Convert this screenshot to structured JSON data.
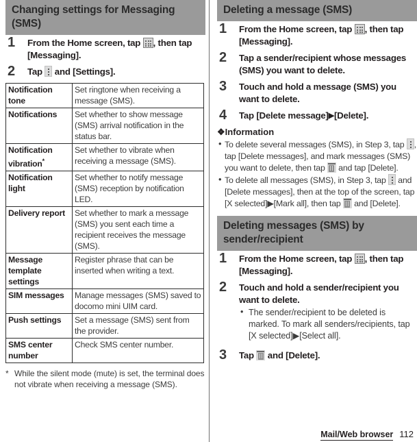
{
  "page": {
    "footer_chapter": "Mail/Web browser",
    "footer_page": "112"
  },
  "left": {
    "section_title": "Changing settings for Messaging (SMS)",
    "steps": [
      {
        "num": "1",
        "pre": "From the Home screen, tap ",
        "icon": "apps-grid-icon",
        "post": ", then tap [Messaging]."
      },
      {
        "num": "2",
        "pre": "Tap ",
        "icon": "overflow-menu-icon",
        "post": " and [Settings]."
      }
    ],
    "table": {
      "rows": [
        {
          "key": "Notification tone",
          "value": "Set ringtone when receiving a message (SMS)."
        },
        {
          "key": "Notifications",
          "value": "Set whether to show message (SMS) arrival notification in the status bar."
        },
        {
          "key": "Notification vibration",
          "key_star": "*",
          "value": "Set whether to vibrate when receiving a message (SMS)."
        },
        {
          "key": "Notification light",
          "value": "Set whether to notify message (SMS) reception by notification LED."
        },
        {
          "key": "Delivery report",
          "value": "Set whether to mark a message (SMS) you sent each time a recipient receives the message (SMS)."
        },
        {
          "key": "Message template settings",
          "value": "Register phrase that can be inserted when writing a text."
        },
        {
          "key": "SIM messages",
          "value": "Manage messages (SMS) saved to docomo mini UIM card."
        },
        {
          "key": "Push settings",
          "value": "Set a message (SMS) sent from the provider."
        },
        {
          "key": "SMS center number",
          "value": "Check SMS center number."
        }
      ]
    },
    "footnote_marker": "*",
    "footnote": "While the silent mode (mute) is set, the terminal does not vibrate when receiving a message (SMS)."
  },
  "right": {
    "section1": {
      "title": "Deleting a message (SMS)",
      "steps": [
        {
          "num": "1",
          "pre": "From the Home screen, tap ",
          "icon": "apps-grid-icon",
          "post": ", then tap [Messaging]."
        },
        {
          "num": "2",
          "pre": "Tap a sender/recipient whose messages (SMS) you want to delete.",
          "icon": "",
          "post": ""
        },
        {
          "num": "3",
          "pre": "Touch and hold a message (SMS) you want to delete.",
          "icon": "",
          "post": ""
        },
        {
          "num": "4",
          "pre": "Tap [Delete message]",
          "icon": "arrow-right-icon",
          "post": "[Delete]."
        }
      ]
    },
    "information": {
      "title": "Information",
      "bullets": [
        {
          "p1": "To delete several messages (SMS), in Step 3, tap ",
          "i1": "overflow-menu-icon",
          "p2": ", tap [Delete messages], and mark messages (SMS) you want to delete, then tap ",
          "i2": "trash-icon",
          "p3": " and tap [Delete]."
        },
        {
          "p1": "To delete all messages (SMS), in Step 3, tap ",
          "i1": "overflow-menu-icon",
          "p2": " and [Delete messages], then at the top of the screen, tap [X selected]▶[Mark all], then tap ",
          "i2": "trash-icon",
          "p3": " and [Delete]."
        }
      ]
    },
    "section2": {
      "title": "Deleting messages (SMS) by sender/recipient",
      "steps": [
        {
          "num": "1",
          "pre": "From the Home screen, tap ",
          "icon": "apps-grid-icon",
          "post": ", then tap [Messaging]."
        },
        {
          "num": "2",
          "pre": "Touch and hold a sender/recipient you want to delete.",
          "icon": "",
          "post": ""
        },
        {
          "num": "3",
          "pre": "Tap ",
          "icon": "trash-icon",
          "post": " and [Delete]."
        }
      ],
      "substep": "The sender/recipient to be deleted is marked. To mark all senders/recipients, tap [X selected]▶[Select all]."
    }
  },
  "glyphs": {
    "bullet": "•",
    "arrow": "▶",
    "diamond": "❖"
  }
}
